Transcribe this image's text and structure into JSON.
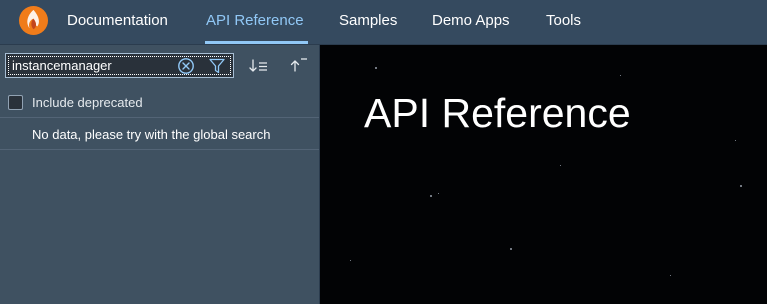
{
  "nav": {
    "links": [
      "Documentation",
      "API Reference",
      "Samples",
      "Demo Apps",
      "Tools"
    ],
    "active": "API Reference"
  },
  "sidebar": {
    "search": {
      "value": "instancemanager",
      "placeholder": ""
    },
    "include_deprecated_label": "Include deprecated",
    "include_deprecated_checked": false,
    "empty_message": "No data, please try with the global search"
  },
  "main": {
    "title": "API Reference"
  },
  "icons": {
    "logo": "openui5-flame-logo",
    "clear": "clear-circle-icon",
    "filter": "filter-funnel-icon",
    "sort": "sort-descending-icon",
    "collapse": "collapse-all-icon"
  },
  "colors": {
    "shell": "#354a5f",
    "sidebar": "#3f5161",
    "accent": "#91c8f6",
    "logo_orange": "#f07c1a"
  }
}
